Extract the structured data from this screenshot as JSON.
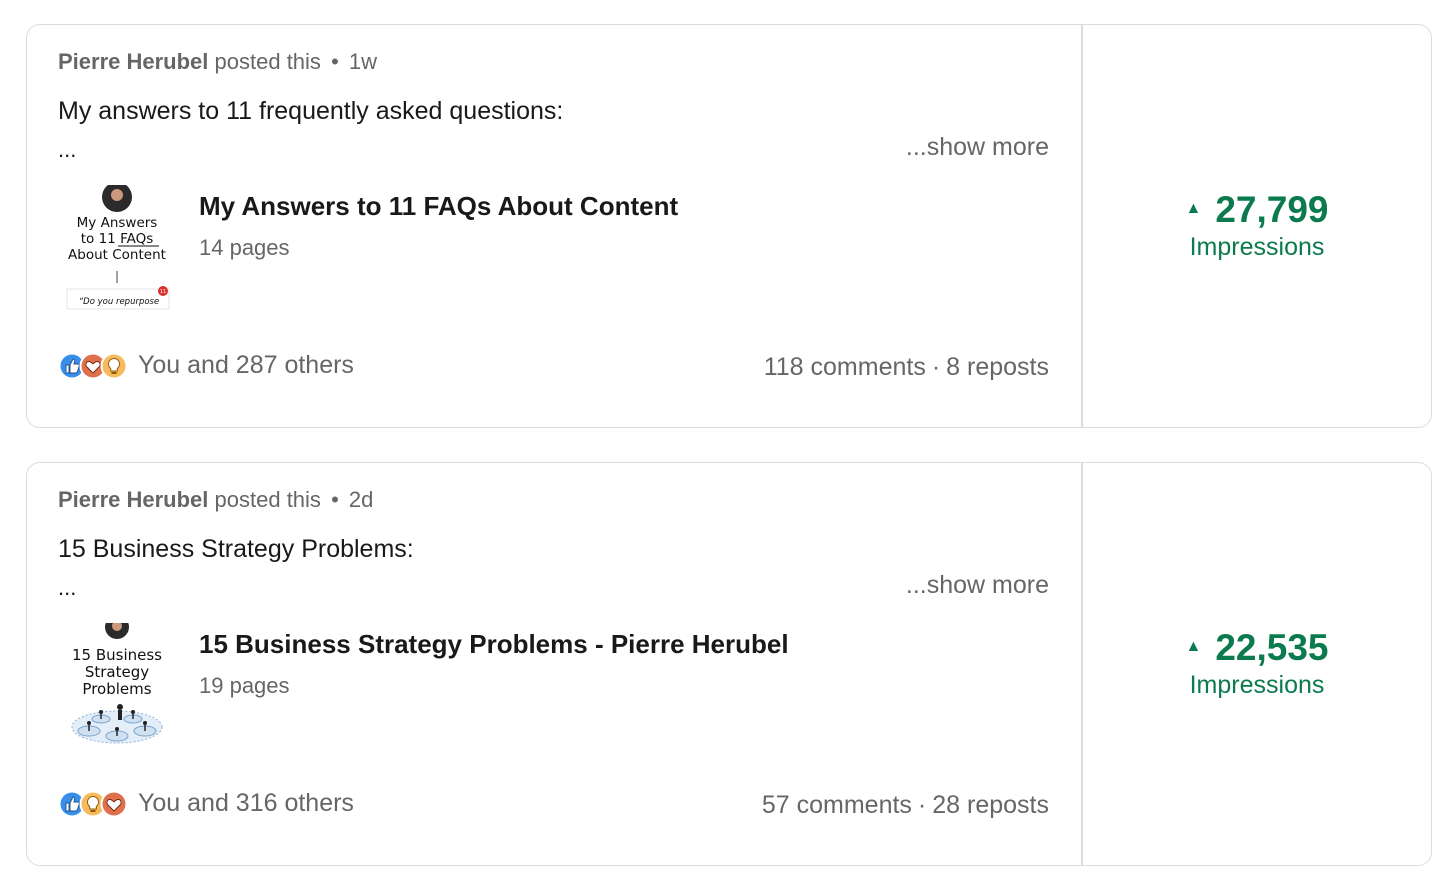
{
  "posts": [
    {
      "author": "Pierre Herubel",
      "action": "posted this",
      "dot": "•",
      "time": "1w",
      "headline": "My answers to 11 frequently asked questions:",
      "ellipsis": "...",
      "show_more": "...show more",
      "document": {
        "thumb_lines": [
          "My Answers",
          "to 11 FAQs",
          "About Content"
        ],
        "thumb_quote": "“Do you repurpose",
        "thumb_badge": "11",
        "title": "My Answers to 11 FAQs About Content",
        "pages": "14 pages"
      },
      "reaction_icons": [
        "like-icon",
        "love-icon",
        "insightful-icon"
      ],
      "reactions_text": "You and 287 others",
      "comments": "118 comments",
      "sep": "·",
      "reposts": "8 reposts",
      "impressions": "27,799",
      "impressions_label": "Impressions",
      "trend_arrow": "▲"
    },
    {
      "author": "Pierre Herubel",
      "action": "posted this",
      "dot": "•",
      "time": "2d",
      "headline": "15 Business Strategy Problems:",
      "ellipsis": "...",
      "show_more": "...show more",
      "document": {
        "thumb_lines": [
          "15 Business",
          "Strategy",
          "Problems"
        ],
        "title": "15 Business Strategy Problems - Pierre Herubel",
        "pages": "19 pages"
      },
      "reaction_icons": [
        "like-icon",
        "insightful-icon",
        "love-icon"
      ],
      "reactions_text": "You and 316 others",
      "comments": "57 comments",
      "sep": "·",
      "reposts": "28 reposts",
      "impressions": "22,535",
      "impressions_label": "Impressions",
      "trend_arrow": "▲"
    }
  ],
  "colors": {
    "impressions_green": "#0b7a4e",
    "muted_text": "#666666",
    "border": "#dcdcdc",
    "like_blue": "#378fe9",
    "love_red": "#df704d",
    "insight_yellow": "#f5bb5c"
  }
}
